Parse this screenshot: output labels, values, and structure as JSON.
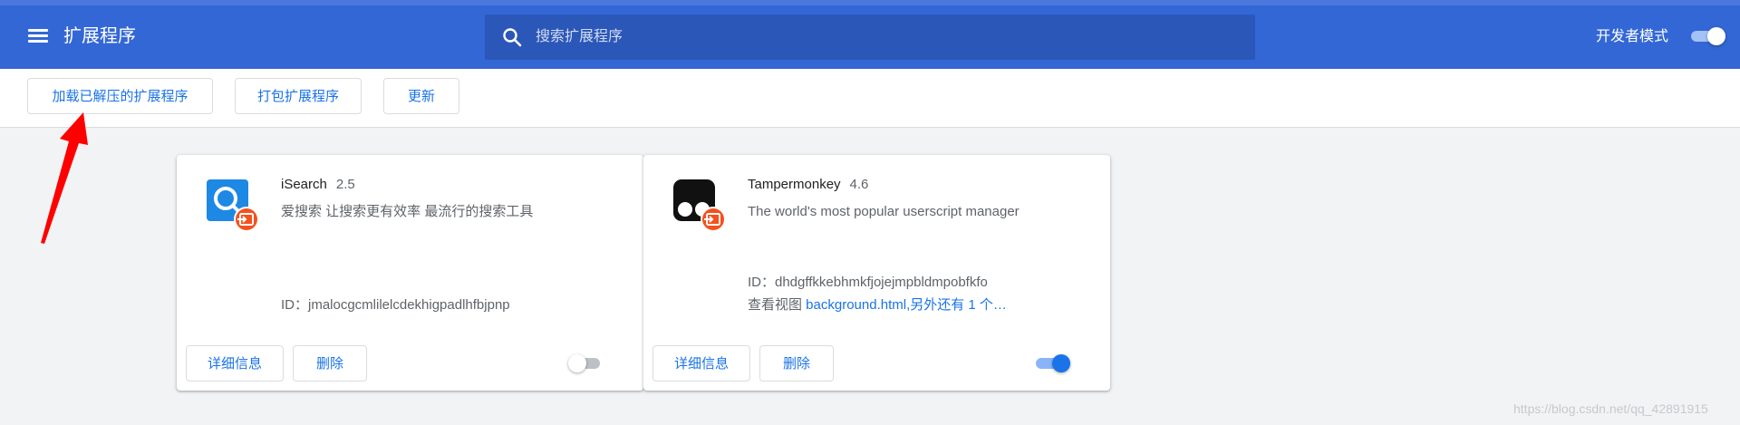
{
  "header": {
    "title": "扩展程序",
    "search_placeholder": "搜索扩展程序",
    "developer_mode_label": "开发者模式",
    "developer_mode_on": true
  },
  "toolbar": {
    "load_unpacked_label": "加载已解压的扩展程序",
    "pack_label": "打包扩展程序",
    "update_label": "更新"
  },
  "extensions": [
    {
      "name": "iSearch",
      "version": "2.5",
      "description": "爱搜索 让搜索更有效率 最流行的搜索工具",
      "id_text": "ID：jmalocgcmlilelcdekhigpadlhfbjpnp",
      "details_label": "详细信息",
      "remove_label": "删除",
      "enabled": false
    },
    {
      "name": "Tampermonkey",
      "version": "4.6",
      "description": "The world's most popular userscript manager",
      "id_text": "ID：dhdgffkkebhmkfjojejmpbldmpobfkfo",
      "views_prefix": "查看视图 ",
      "views_link": "background.html,另外还有 1 个…",
      "details_label": "详细信息",
      "remove_label": "删除",
      "enabled": true
    }
  ],
  "watermark": "https://blog.csdn.net/qq_42891915",
  "colors": {
    "header_bg": "#3367d6",
    "accent": "#1a73e8",
    "annotation_arrow": "#ff0000"
  }
}
